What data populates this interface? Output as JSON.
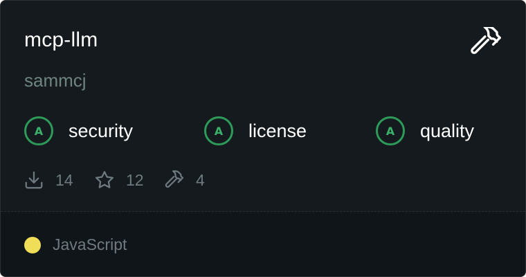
{
  "server": {
    "name": "mcp-llm",
    "author": "sammcj"
  },
  "grades": [
    {
      "grade": "A",
      "label": "security"
    },
    {
      "grade": "A",
      "label": "license"
    },
    {
      "grade": "A",
      "label": "quality"
    }
  ],
  "stats": {
    "downloads": "14",
    "stars": "12",
    "tools": "4"
  },
  "language": {
    "name": "JavaScript",
    "color": "#f1de58"
  },
  "icons": {
    "header": "hammer-icon",
    "downloads": "download-icon",
    "stars": "star-icon",
    "tools": "hammer-icon"
  },
  "colors": {
    "card_background": "#141a1d",
    "footer_background": "#10151a",
    "grade_ring": "#2e9a5a",
    "muted_text": "#6f7a80",
    "author_text": "#6f8480"
  }
}
